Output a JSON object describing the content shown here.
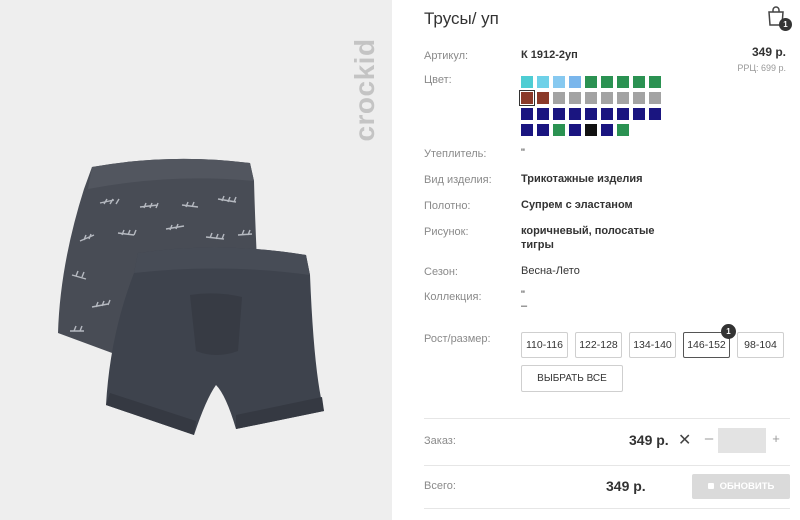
{
  "product": {
    "title": "Трусы/ уп",
    "brand": "crockid"
  },
  "cart": {
    "count": "1",
    "icon": "shopping-bag-icon"
  },
  "details": {
    "article_label": "Артикул:",
    "article_value": "К 1912-2уп",
    "price": "349 р.",
    "rrp": "РРЦ: 699 р.",
    "color_label": "Цвет:",
    "insulation_label": "Утеплитель:",
    "insulation_value": "\"",
    "type_label": "Вид изделия:",
    "type_value": "Трикотажные изделия",
    "fabric_label": "Полотно:",
    "fabric_value": "Супрем с эластаном",
    "pattern_label": "Рисунок:",
    "pattern_value_1": "коричневый, полосатые",
    "pattern_value_2": "тигры",
    "season_label": "Сезон:",
    "season_value": "Весна-Лето",
    "collection_label": "Коллекция:",
    "collection_value_1": "\"",
    "collection_value_2": "–"
  },
  "swatches": [
    [
      "#4ecdd3",
      "#6ed1e8",
      "#87c9f0",
      "#7ab6ec",
      "#2b9252",
      "#2b9252",
      "#2b9252",
      "#2b9252",
      "#2b9252"
    ],
    [
      "#8b3a2a",
      "#8b3a2a",
      "#a3a3a3",
      "#a3a3a3",
      "#a3a3a3",
      "#a3a3a3",
      "#a3a3a3",
      "#a3a3a3",
      "#a3a3a3"
    ],
    [
      "#1a1580",
      "#1a1580",
      "#1a1580",
      "#1a1580",
      "#1a1580",
      "#1a1580",
      "#1a1580",
      "#1a1580",
      "#1a1580"
    ],
    [
      "#1a1580",
      "#1a1580",
      "#2b9252",
      "#1a1580",
      "#111111",
      "#1a1580",
      "#2b9252"
    ]
  ],
  "selected_swatch": "row 2, item 1",
  "sizes": {
    "label": "Рост/размер:",
    "options": [
      "110-116",
      "122-128",
      "134-140",
      "146-152",
      "98-104"
    ],
    "selected": "146-152",
    "selected_count": "1",
    "select_all": "ВЫБРАТЬ ВСЕ"
  },
  "order": {
    "label": "Заказ:",
    "price": "349 р.",
    "times": "✕",
    "minus": "–",
    "quantity": "",
    "plus": "+"
  },
  "total": {
    "label": "Всего:",
    "price": "349 р.",
    "update_button": "ОБНОВИТЬ"
  }
}
